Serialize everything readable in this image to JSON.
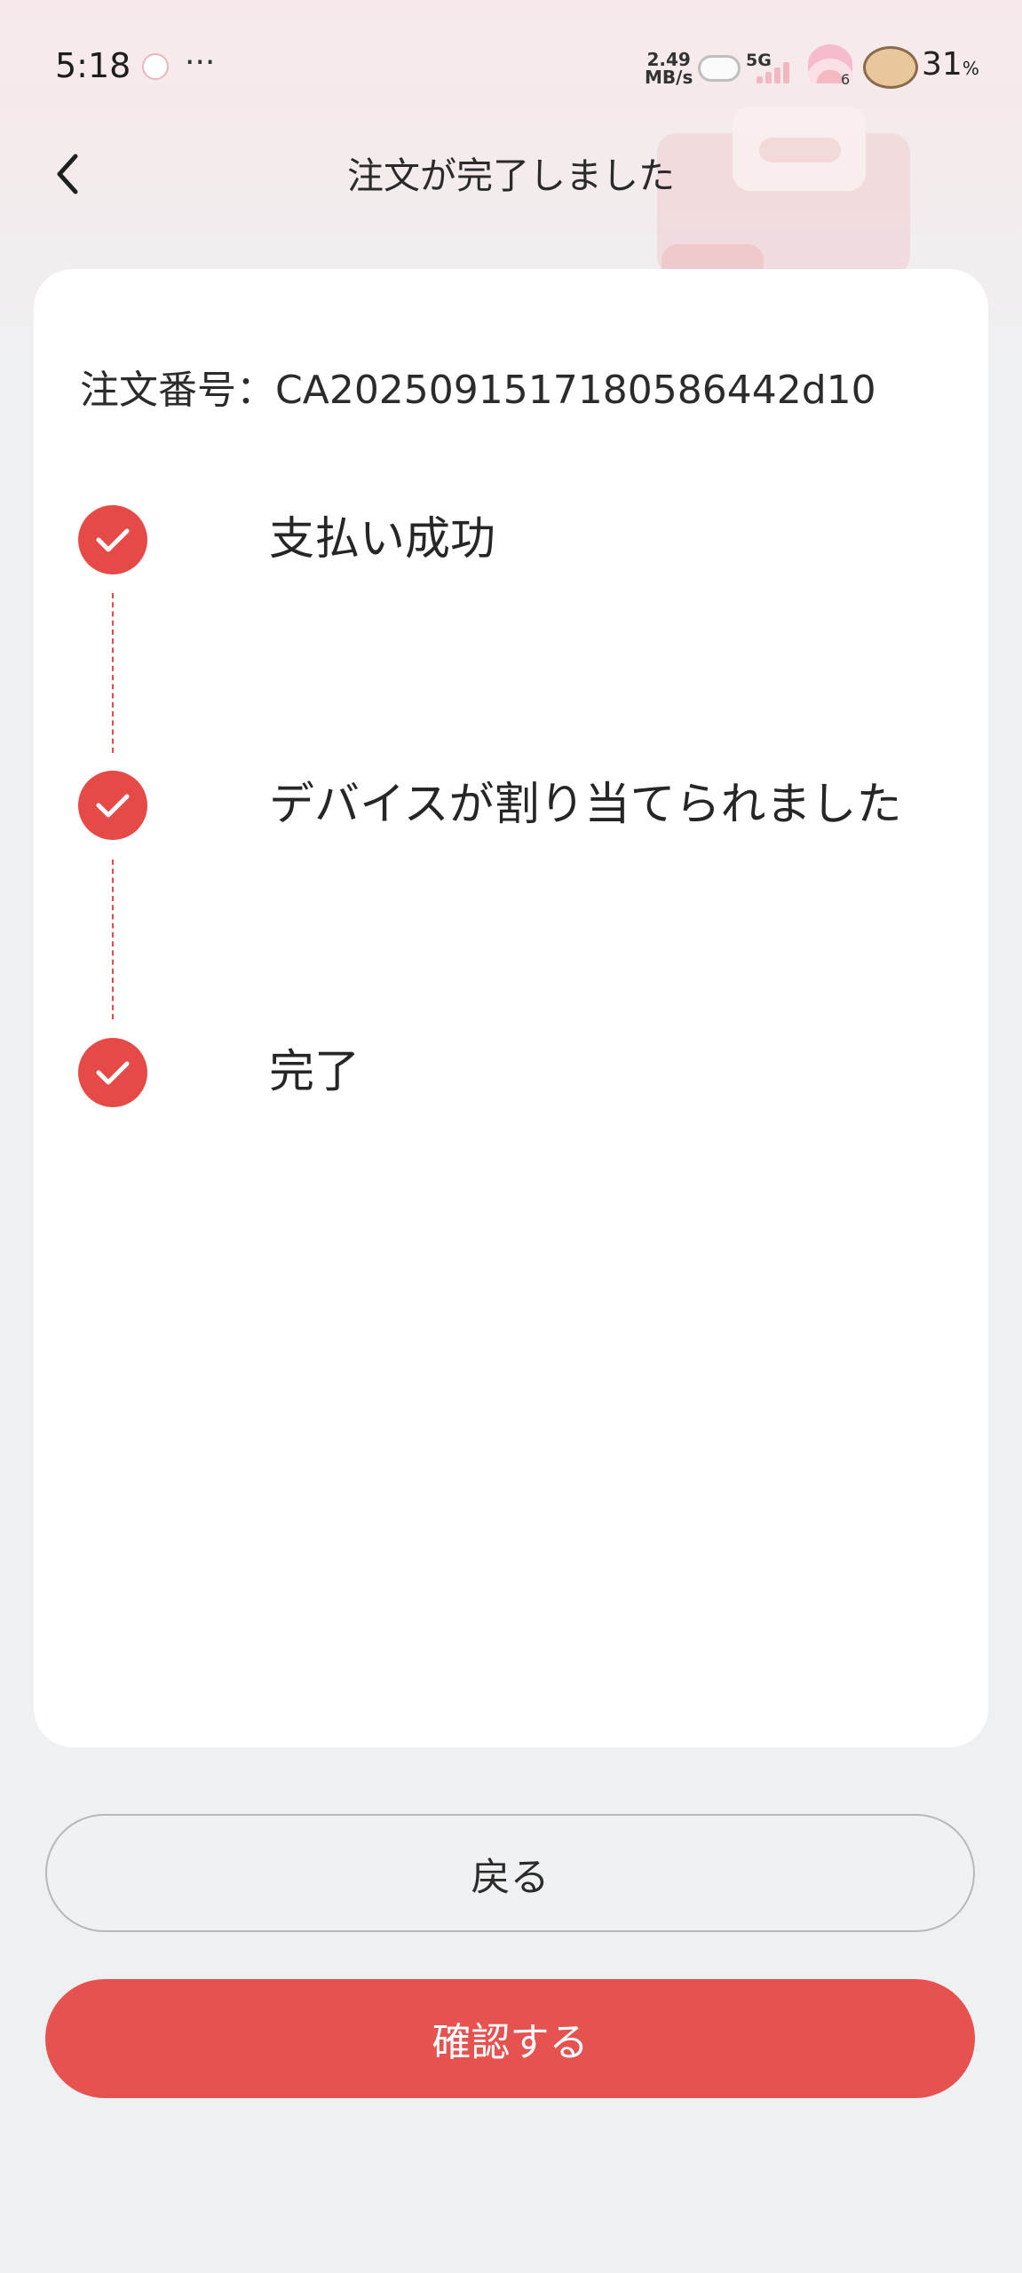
{
  "status_bar": {
    "time": "5:18",
    "more": "···",
    "speed_value": "2.49",
    "speed_unit": "MB/s",
    "network": "5G",
    "wifi_count": "6",
    "battery_value": "31",
    "battery_unit": "%"
  },
  "nav": {
    "back_icon": "chevron-left-icon",
    "title": "注文が完了しました"
  },
  "order": {
    "number_label": "注文番号：",
    "number_value": "CA2025091517180586442d10"
  },
  "steps": [
    {
      "label": "支払い成功",
      "status": "done",
      "icon": "check-circle-icon"
    },
    {
      "label": "デバイスが割り当てられました",
      "status": "done",
      "icon": "check-circle-icon"
    },
    {
      "label": "完了",
      "status": "done",
      "icon": "check-circle-icon"
    }
  ],
  "actions": {
    "back_label": "戻る",
    "confirm_label": "確認する"
  },
  "colors": {
    "accent": "#e64a47",
    "confirm_button": "#e55250",
    "background": "#eff0f2",
    "card": "#ffffff"
  }
}
